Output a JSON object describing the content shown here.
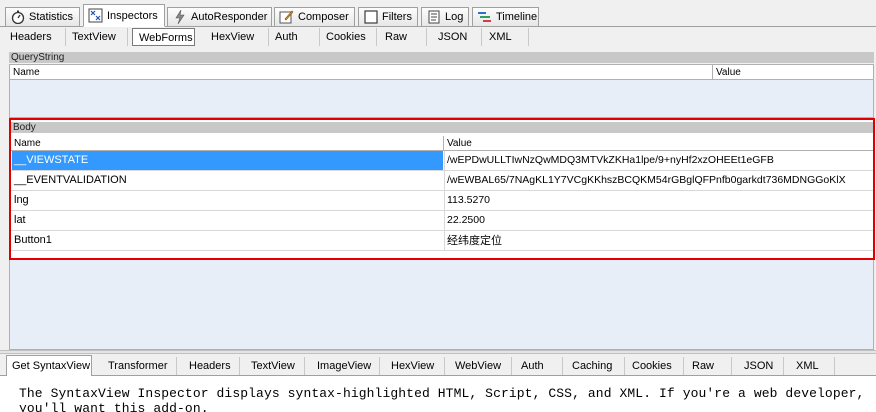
{
  "main_tabs": [
    {
      "label": "Statistics",
      "icon": "stopwatch-icon"
    },
    {
      "label": "Inspectors",
      "icon": "inspectors-icon"
    },
    {
      "label": "AutoResponder",
      "icon": "lightning-icon"
    },
    {
      "label": "Composer",
      "icon": "compose-icon"
    },
    {
      "label": "Filters",
      "icon": "checkbox-icon"
    },
    {
      "label": "Log",
      "icon": "log-icon"
    },
    {
      "label": "Timeline",
      "icon": "timeline-icon"
    }
  ],
  "sub_tabs": [
    "Headers",
    "TextView",
    "WebForms",
    "HexView",
    "Auth",
    "Cookies",
    "Raw",
    "JSON",
    "XML"
  ],
  "querystring": {
    "title": "QueryString",
    "col_name": "Name",
    "col_value": "Value"
  },
  "body": {
    "title": "Body",
    "col_name": "Name",
    "col_value": "Value",
    "rows": [
      {
        "name": "__VIEWSTATE",
        "value": "/wEPDwULLTIwNzQwMDQ3MTVkZKHa1lpe/9+nyHf2xzOHEEt1eGFB"
      },
      {
        "name": "__EVENTVALIDATION",
        "value": "/wEWBAL65/7NAgKL1Y7VCgKKhszBCQKM54rGBglQFPnfb0garkdt736MDNGGoKlX"
      },
      {
        "name": "lng",
        "value": "113.5270"
      },
      {
        "name": "lat",
        "value": "22.2500"
      },
      {
        "name": "Button1",
        "value": "经纬度定位"
      }
    ]
  },
  "bottom_tabs": [
    "Get SyntaxView",
    "Transformer",
    "Headers",
    "TextView",
    "ImageView",
    "HexView",
    "WebView",
    "Auth",
    "Caching",
    "Cookies",
    "Raw",
    "JSON",
    "XML"
  ],
  "description": "The SyntaxView Inspector displays syntax-highlighted HTML, Script, CSS, and XML. If you're a web developer, you'll want this add-on."
}
